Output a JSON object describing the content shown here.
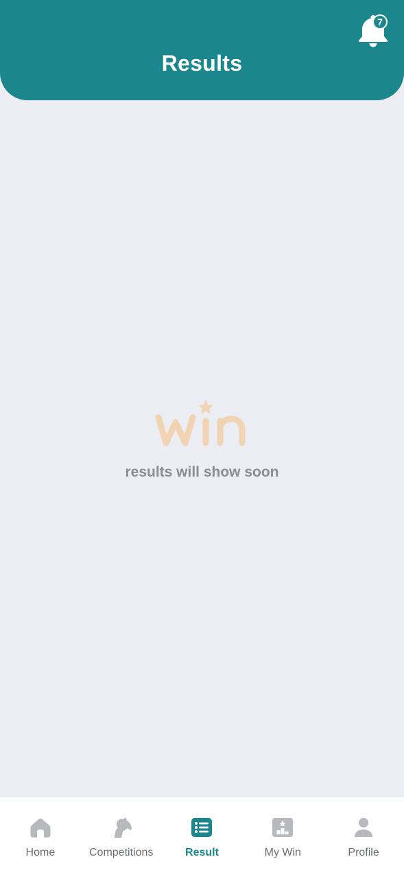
{
  "header": {
    "title": "Results",
    "notifications_count": "7"
  },
  "empty_state": {
    "logo_text": "win",
    "message": "results will show soon"
  },
  "tabs": [
    {
      "label": "Home",
      "icon": "home-icon",
      "active": false
    },
    {
      "label": "Competitions",
      "icon": "horse-icon",
      "active": false
    },
    {
      "label": "Result",
      "icon": "list-icon",
      "active": true
    },
    {
      "label": "My Win",
      "icon": "podium-icon",
      "active": false
    },
    {
      "label": "Profile",
      "icon": "user-icon",
      "active": false
    }
  ],
  "colors": {
    "primary": "#1b868c",
    "background": "#eceef3",
    "logo": "#f1d4b3",
    "inactive_icon": "#b8b9bc",
    "muted_text": "#8a8d93"
  }
}
